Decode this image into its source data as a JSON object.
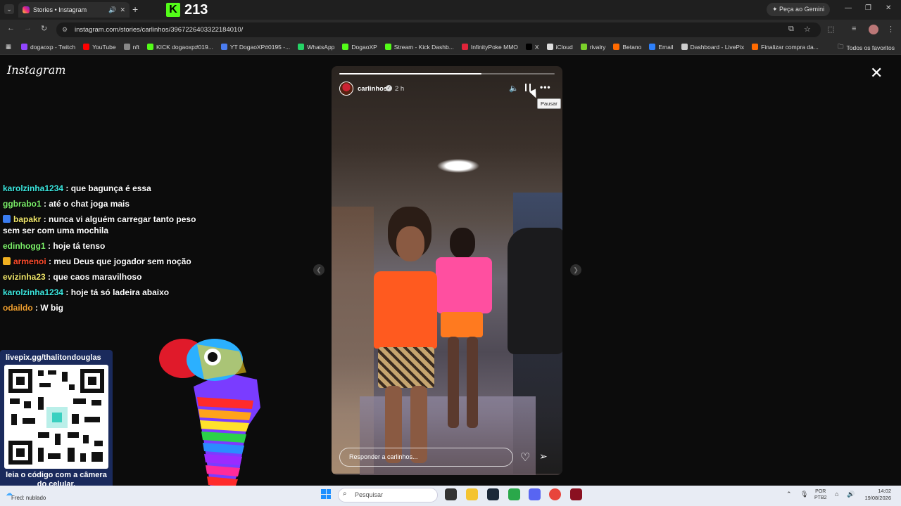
{
  "browser": {
    "tab_title": "Stories • Instagram",
    "tab_audio_icon": "speaker-icon",
    "tab_close": "✕",
    "new_tab": "+",
    "url": "instagram.com/stories/carlinhos/3967226403322184010/",
    "gemini_button": "Peça ao Gemini",
    "bookmarks": [
      {
        "label": "dogaoxp - Twitch",
        "color": "#9146ff"
      },
      {
        "label": "YouTube",
        "color": "#ff0000"
      },
      {
        "label": "nft",
        "color": "#888888"
      },
      {
        "label": "KICK dogaoxp#019...",
        "color": "#53fc18"
      },
      {
        "label": "YT DogaoXP#0195 -...",
        "color": "#4a7cf0"
      },
      {
        "label": "WhatsApp",
        "color": "#25d366"
      },
      {
        "label": "DogaoXP",
        "color": "#53fc18"
      },
      {
        "label": "Stream - Kick Dashb...",
        "color": "#53fc18"
      },
      {
        "label": "InfinityPoke MMO",
        "color": "#e0243a"
      },
      {
        "label": "X",
        "color": "#000000"
      },
      {
        "label": "iCloud",
        "color": "#dddddd"
      },
      {
        "label": "rivalry",
        "color": "#7bd12a"
      },
      {
        "label": "Betano",
        "color": "#ff6a00"
      },
      {
        "label": "Email",
        "color": "#2d7ff9"
      },
      {
        "label": "Dashboard - LivePix",
        "color": "#cccccc"
      },
      {
        "label": "Finalizar compra da...",
        "color": "#ff6a00"
      }
    ],
    "bookmarks_all": "Todos os favoritos"
  },
  "overlay": {
    "kick_count": "213",
    "kick_logo": "K"
  },
  "instagram": {
    "logo": "Instagram",
    "story": {
      "username": "carlinhos",
      "verified_icon": "verified-badge-icon",
      "time": "2 h",
      "pause_tooltip": "Pausar",
      "reply_placeholder": "Responder a carlinhos...",
      "progress": 0.66
    }
  },
  "chat": [
    {
      "user": "karolzinha1234",
      "color": "#3ce8e0",
      "text": ": que bagunça é essa",
      "badge": null
    },
    {
      "user": "ggbrabo1",
      "color": "#7cf06a",
      "text": ": até o chat joga mais",
      "badge": null
    },
    {
      "user": "bapakr",
      "color": "#f0e66a",
      "text": ": nunca vi alguém carregar tanto peso sem ser com uma mochila",
      "badge": "#3a7cf0"
    },
    {
      "user": "edinhogg1",
      "color": "#7cf06a",
      "text": ": hoje tá tenso",
      "badge": null
    },
    {
      "user": "armenoi",
      "color": "#ff4b2b",
      "text": ": meu Deus que jogador sem noção",
      "badge": "#f0b020"
    },
    {
      "user": "evizinha23",
      "color": "#f0e66a",
      "text": ": que caos maravilhoso",
      "badge": null
    },
    {
      "user": "karolzinha1234",
      "color": "#3ce8e0",
      "text": ": hoje tá só ladeira abaixo",
      "badge": null
    },
    {
      "user": "odaildo",
      "color": "#f0a030",
      "text": ": W big",
      "badge": null
    }
  ],
  "donation": {
    "url": "livepix.gg/thalitondouglas",
    "caption": "leia o código com a câmera do celular."
  },
  "taskbar": {
    "weather": "Fred: nublado",
    "search_placeholder": "Pesquisar",
    "lang_line1": "POR",
    "lang_line2": "PTB2",
    "time": "14:02",
    "date": "19/08/2026"
  }
}
